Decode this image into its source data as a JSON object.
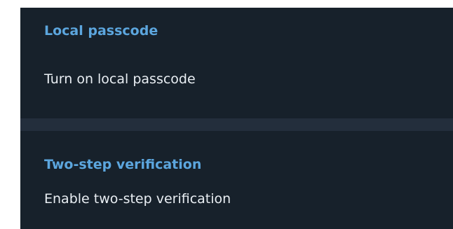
{
  "sections": [
    {
      "title": "Local passcode",
      "items": [
        {
          "label": "Turn on local passcode"
        }
      ]
    },
    {
      "title": "Two-step verification",
      "items": [
        {
          "label": "Enable two-step verification"
        }
      ]
    }
  ],
  "colors": {
    "background": "#17212b",
    "divider": "#232e3c",
    "section_title": "#5ca6de",
    "item_text": "#e9eef3"
  }
}
